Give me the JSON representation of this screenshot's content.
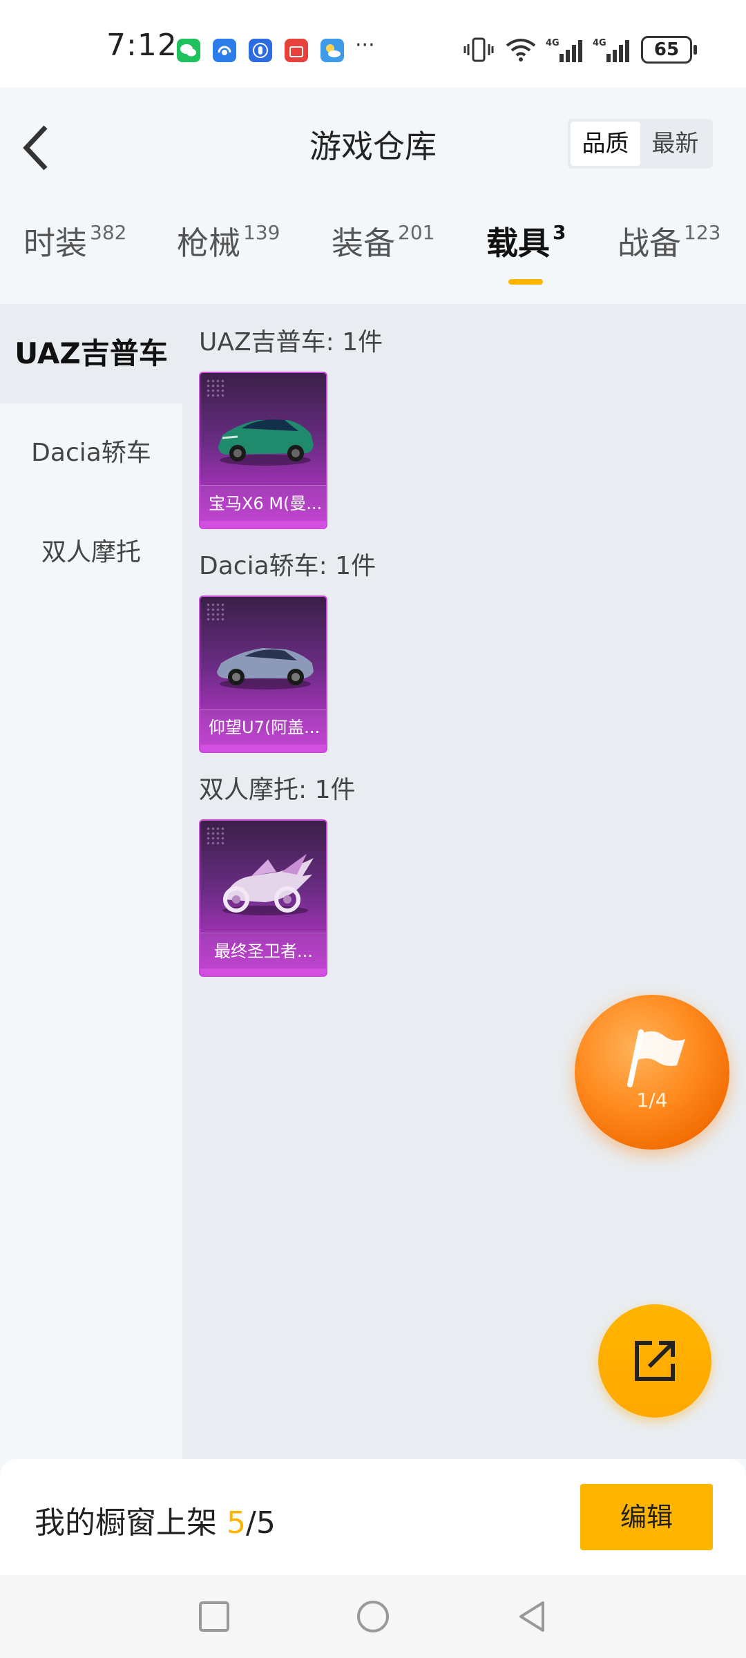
{
  "status_bar": {
    "time": "7:12",
    "more": "···",
    "battery": "65",
    "app_icons": [
      "wechat-icon",
      "headset-app-icon",
      "hand-app-icon",
      "huawei-appgallery-icon",
      "weather-icon"
    ]
  },
  "header": {
    "title": "游戏仓库",
    "sort_options": [
      "品质",
      "最新"
    ],
    "active_sort": "品质"
  },
  "tabs": [
    {
      "label": "时装",
      "count": "382"
    },
    {
      "label": "枪械",
      "count": "139"
    },
    {
      "label": "装备",
      "count": "201"
    },
    {
      "label": "载具",
      "count": "3"
    },
    {
      "label": "战备",
      "count": "123"
    }
  ],
  "active_tab": "载具",
  "side_nav": [
    "UAZ吉普车",
    "Dacia轿车",
    "双人摩托"
  ],
  "active_side": "UAZ吉普车",
  "groups": [
    {
      "title": "UAZ吉普车: 1件",
      "item_name": "宝马X6 M(曼..."
    },
    {
      "title": "Dacia轿车: 1件",
      "item_name": "仰望U7(阿盖..."
    },
    {
      "title": "双人摩托: 1件",
      "item_name": "最终圣卫者..."
    }
  ],
  "flag_fab": {
    "progress": "1/4"
  },
  "bottom": {
    "label": "我的橱窗上架 ",
    "current": "5",
    "total": "/5",
    "edit": "编辑"
  },
  "colors": {
    "accent": "#ffb400",
    "card_purple": "#a533b8",
    "fab_orange": "#ff8a1e"
  }
}
